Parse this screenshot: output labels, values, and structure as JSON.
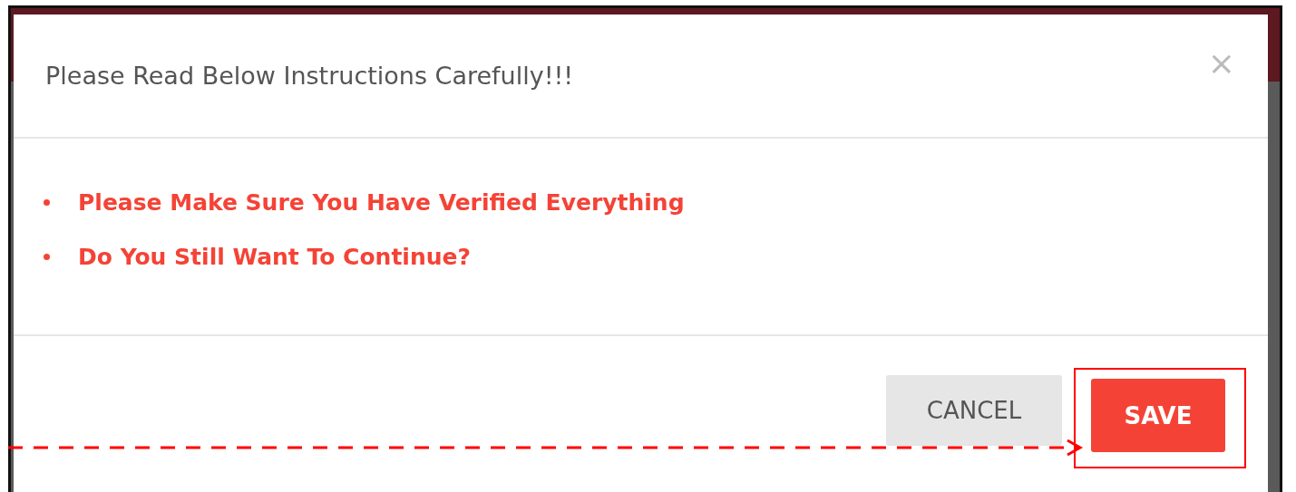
{
  "dialog": {
    "title": "Please Read Below Instructions Carefully!!!",
    "close": "×",
    "instructions": [
      "Please Make Sure You Have Verified Everything",
      "Do You Still Want To Continue?"
    ],
    "buttons": [
      {
        "label": "CANCEL",
        "kind": "secondary",
        "highlighted": false
      },
      {
        "label": "SAVE",
        "kind": "primary",
        "highlighted": true
      }
    ]
  }
}
